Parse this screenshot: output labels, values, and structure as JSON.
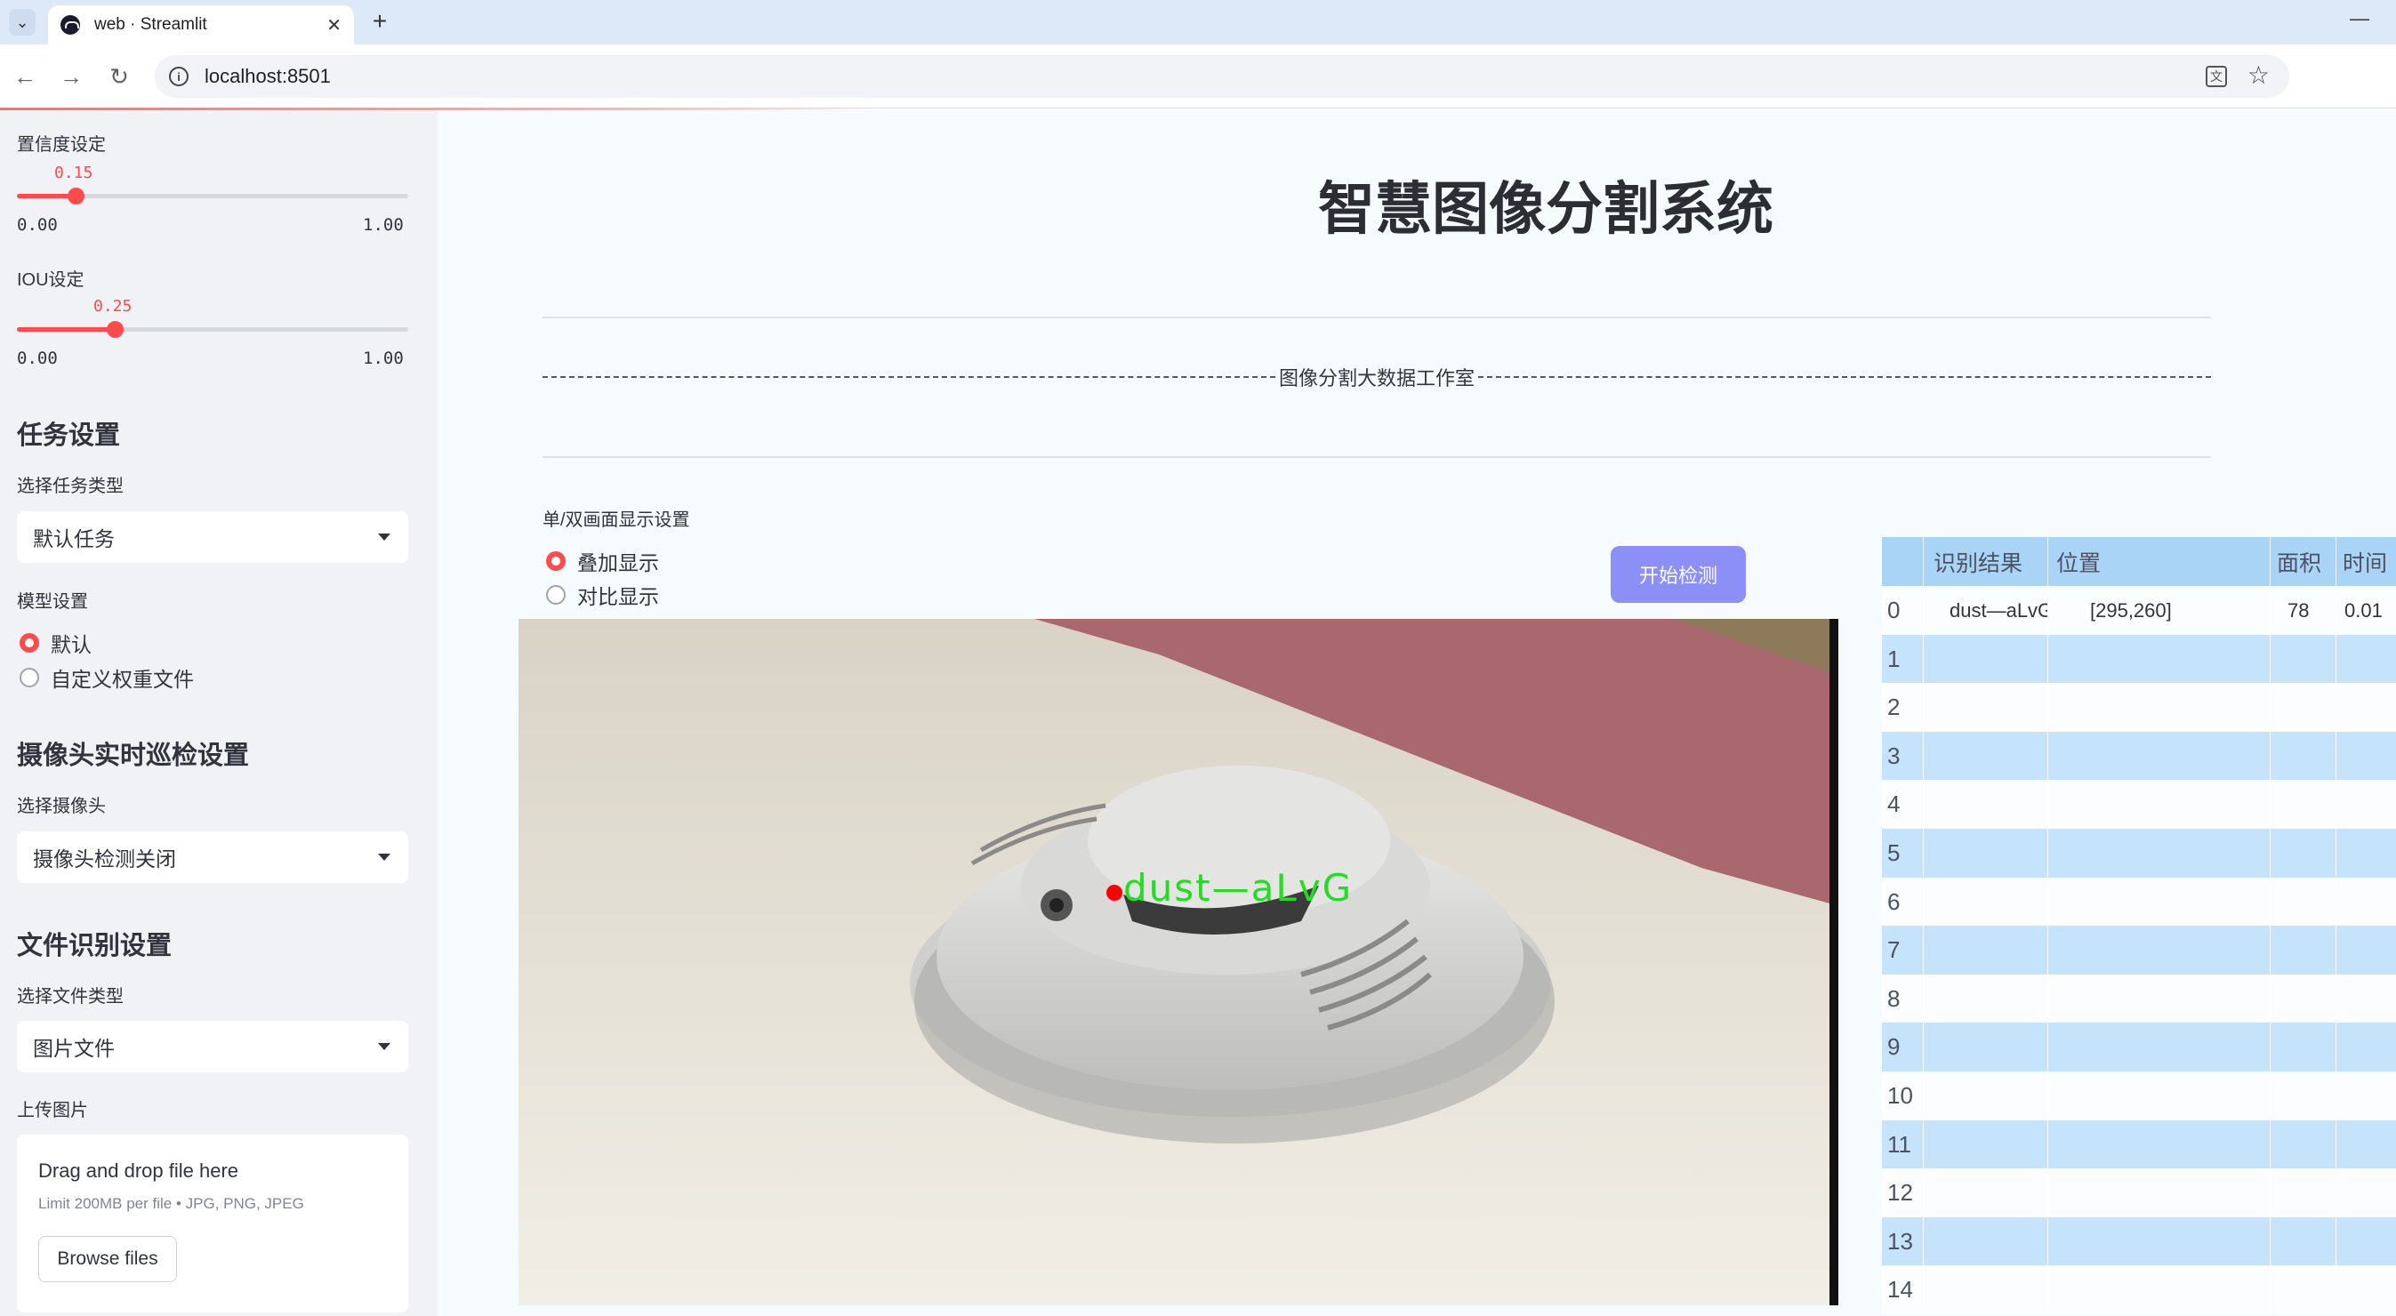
{
  "browser": {
    "tab_title": "web · Streamlit",
    "url": "localhost:8501"
  },
  "sidebar": {
    "confidence": {
      "label": "置信度设定",
      "value": "0.15",
      "min": "0.00",
      "max": "1.00",
      "fraction": 0.15
    },
    "iou": {
      "label": "IOU设定",
      "value": "0.25",
      "min": "0.00",
      "max": "1.00",
      "fraction": 0.25
    },
    "task_heading": "任务设置",
    "task_type_label": "选择任务类型",
    "task_type_value": "默认任务",
    "model_label": "模型设置",
    "model_options": [
      "默认",
      "自定义权重文件"
    ],
    "model_selected": 0,
    "camera_heading": "摄像头实时巡检设置",
    "camera_label": "选择摄像头",
    "camera_value": "摄像头检测关闭",
    "file_heading": "文件识别设置",
    "file_type_label": "选择文件类型",
    "file_type_value": "图片文件",
    "upload_label": "上传图片",
    "upload": {
      "drag_text": "Drag and drop file here",
      "limit_text": "Limit 200MB per file • JPG, PNG, JPEG",
      "browse_label": "Browse files"
    }
  },
  "main": {
    "title": "智慧图像分割系统",
    "divider_text": "图像分割大数据工作室",
    "display_mode_label": "单/双画面显示设置",
    "display_options": [
      "叠加显示",
      "对比显示"
    ],
    "display_selected": 0,
    "start_button": "开始检测",
    "detection_label": "dust—aLvG",
    "detection_color": "#22dd22"
  },
  "results_table": {
    "columns": [
      "",
      "识别结果",
      "位置",
      "面积",
      "时间"
    ],
    "rows": [
      {
        "idx": "0",
        "result": "dust—aLvG",
        "position": "[295,260]",
        "area": "78",
        "time": "0.01"
      },
      {
        "idx": "1",
        "result": "",
        "position": "",
        "area": "",
        "time": ""
      },
      {
        "idx": "2",
        "result": "",
        "position": "",
        "area": "",
        "time": ""
      },
      {
        "idx": "3",
        "result": "",
        "position": "",
        "area": "",
        "time": ""
      },
      {
        "idx": "4",
        "result": "",
        "position": "",
        "area": "",
        "time": ""
      },
      {
        "idx": "5",
        "result": "",
        "position": "",
        "area": "",
        "time": ""
      },
      {
        "idx": "6",
        "result": "",
        "position": "",
        "area": "",
        "time": ""
      },
      {
        "idx": "7",
        "result": "",
        "position": "",
        "area": "",
        "time": ""
      },
      {
        "idx": "8",
        "result": "",
        "position": "",
        "area": "",
        "time": ""
      },
      {
        "idx": "9",
        "result": "",
        "position": "",
        "area": "",
        "time": ""
      },
      {
        "idx": "10",
        "result": "",
        "position": "",
        "area": "",
        "time": ""
      },
      {
        "idx": "11",
        "result": "",
        "position": "",
        "area": "",
        "time": ""
      },
      {
        "idx": "12",
        "result": "",
        "position": "",
        "area": "",
        "time": ""
      },
      {
        "idx": "13",
        "result": "",
        "position": "",
        "area": "",
        "time": ""
      },
      {
        "idx": "14",
        "result": "",
        "position": "",
        "area": "",
        "time": ""
      }
    ]
  },
  "colors": {
    "accent": "#ff4b4b",
    "button": "#8b8ff6",
    "table_header": "#a9d4f6",
    "table_alt": "#c5e3fb"
  }
}
